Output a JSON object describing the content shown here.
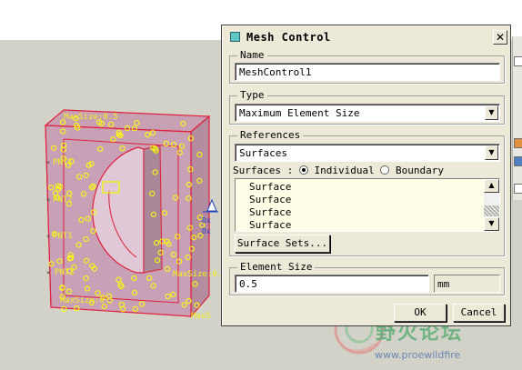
{
  "dialog": {
    "title": "Mesh Control",
    "close_label": "✕",
    "name_group": {
      "legend": "Name",
      "value": "MeshControl1"
    },
    "type_group": {
      "legend": "Type",
      "selected": "Maximum Element Size"
    },
    "references_group": {
      "legend": "References",
      "selected": "Surfaces",
      "surfaces_prefix": "Surfaces :",
      "option_individual": "Individual",
      "option_boundary": "Boundary",
      "individual_selected": true,
      "items": [
        "Surface",
        "Surface",
        "Surface",
        "Surface"
      ],
      "surface_sets_button": "Surface Sets..."
    },
    "element_size_group": {
      "legend": "Element Size",
      "value": "0.5",
      "unit": "mm"
    },
    "ok_button": "OK",
    "cancel_button": "Cancel"
  },
  "model": {
    "point_labels": [
      "PNT1",
      "PNT2",
      "PNT1",
      "PNT3"
    ],
    "max_labels": [
      "MaxSize:0.5",
      "MaxSize:0",
      "MaxSize:0.5",
      "MaxS"
    ],
    "axis_labels": [
      "Dx",
      "Dx"
    ]
  },
  "watermark": {
    "text": "野火论坛",
    "url": "www.proewildfire"
  },
  "colors": {
    "model_fill": "#c8a0b4",
    "model_edge": "#e0203c",
    "mesh_marker": "#ffff00",
    "label_yellow": "#f0f020",
    "dialog_bg": "#ece9d8",
    "viewport_bg": "#d2d2c8"
  }
}
